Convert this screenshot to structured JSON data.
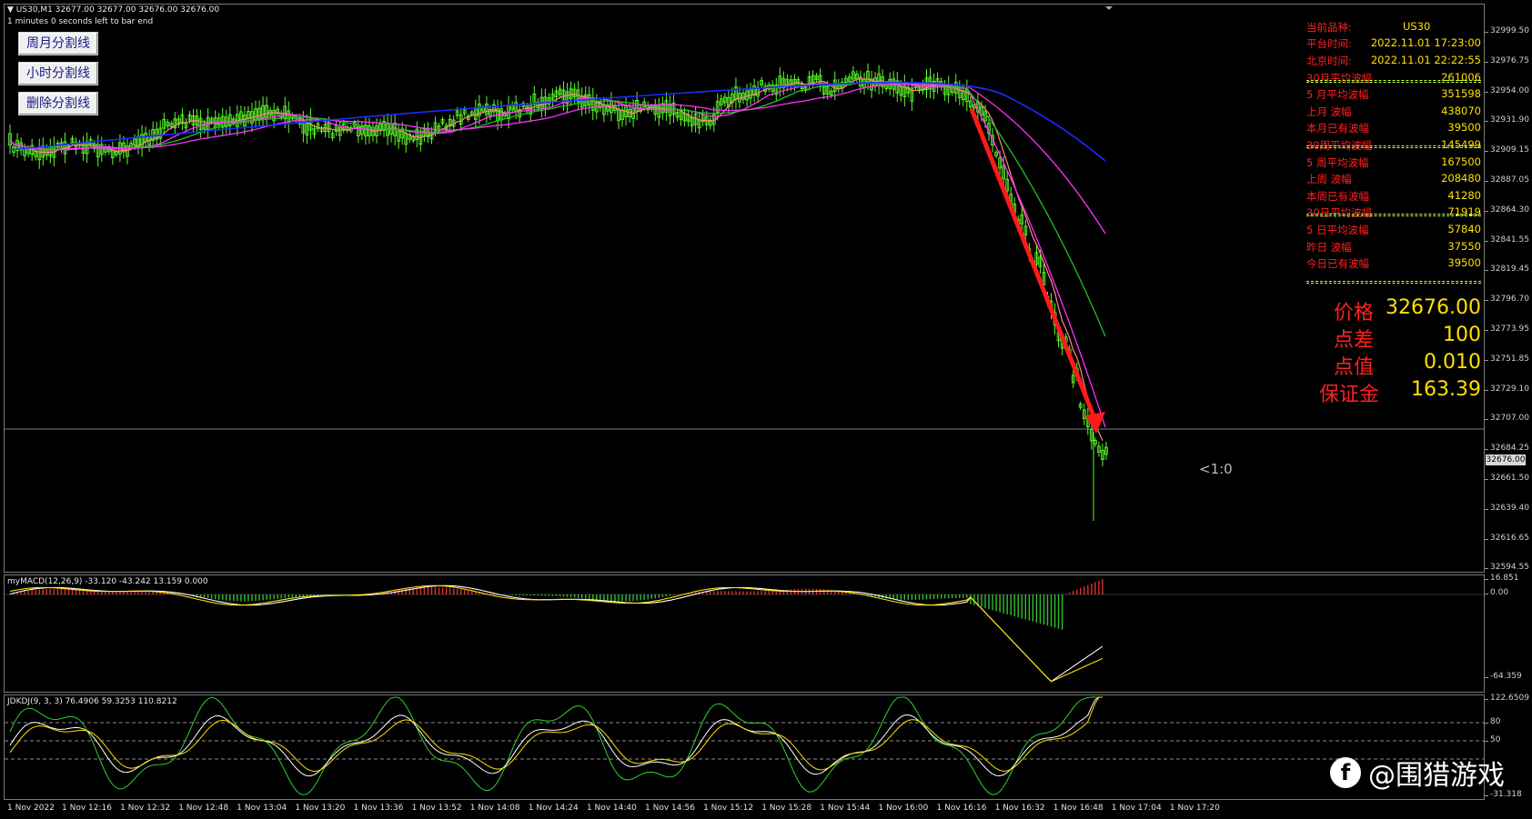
{
  "header": {
    "symbol_line": "US30,M1  32677.00 32677.00 32676.00 32676.00",
    "countdown": "1 minutes 0 seconds left to bar end"
  },
  "buttons": [
    {
      "label": "周月分割线"
    },
    {
      "label": "小时分割线"
    },
    {
      "label": "删除分割线"
    }
  ],
  "info_panel": {
    "rows": [
      {
        "key": "当前品种:",
        "value": "US30",
        "center": true
      },
      {
        "key": "平台时间:",
        "value": "2022.11.01 17:23:00"
      },
      {
        "key": "北京时间:",
        "value": "2022.11.01 22:22:55"
      },
      {
        "key": "30月平均波幅",
        "value": "261006"
      },
      {
        "key": "5 月平均波幅",
        "value": "351598"
      },
      {
        "key": "上月      波幅",
        "value": "438070"
      },
      {
        "key": "本月已有波幅",
        "value": "39500"
      },
      {
        "key": "30周平均波幅",
        "value": "145499"
      },
      {
        "key": "5 周平均波幅",
        "value": "167500"
      },
      {
        "key": "上周      波幅",
        "value": "208480"
      },
      {
        "key": "本周已有波幅",
        "value": "41280"
      },
      {
        "key": "30日平均波幅",
        "value": "71919"
      },
      {
        "key": "5 日平均波幅",
        "value": "57840"
      },
      {
        "key": "昨日      波幅",
        "value": "37550"
      },
      {
        "key": "今日已有波幅",
        "value": "39500"
      }
    ],
    "big_rows": [
      {
        "key": "价格",
        "value": "32676.00"
      },
      {
        "key": "点差",
        "value": "100"
      },
      {
        "key": "点值",
        "value": "0.010"
      },
      {
        "key": "保证金",
        "value": "163.39"
      }
    ]
  },
  "price_scale": [
    "32999.50",
    "32976.75",
    "32954.00",
    "32931.90",
    "32909.15",
    "32887.05",
    "32864.30",
    "32841.55",
    "32819.45",
    "32796.70",
    "32773.95",
    "32751.85",
    "32729.10",
    "32707.00",
    "32684.25",
    "32661.50",
    "32639.40",
    "32616.65",
    "32594.55"
  ],
  "current_price_label": "32676.00",
  "ratio_label": "<1:0",
  "macd": {
    "title": "myMACD(12,26,9) -33.120 -43.242 13.159 0.000",
    "scale": [
      "16.851",
      "0.00",
      "-64.359"
    ]
  },
  "kdj": {
    "title": "JDKDJ(9, 3, 3) 76.4906 59.3253 110.8212",
    "scale": [
      "122.6509",
      "80",
      "50",
      "-31.318"
    ]
  },
  "time_axis": [
    "1 Nov 2022",
    "1 Nov 12:16",
    "1 Nov 12:32",
    "1 Nov 12:48",
    "1 Nov 13:04",
    "1 Nov 13:20",
    "1 Nov 13:36",
    "1 Nov 13:52",
    "1 Nov 14:08",
    "1 Nov 14:24",
    "1 Nov 14:40",
    "1 Nov 14:56",
    "1 Nov 15:12",
    "1 Nov 15:28",
    "1 Nov 15:44",
    "1 Nov 16:00",
    "1 Nov 16:16",
    "1 Nov 16:32",
    "1 Nov 16:48",
    "1 Nov 17:04",
    "1 Nov 17:20"
  ],
  "watermark": {
    "icon": "f",
    "text": "@围猎游戏"
  },
  "colors": {
    "candle": "#5dff2a",
    "ma_fast": "#ff8a80",
    "ma_mid": "#ff30ff",
    "ma_slow": "#22c022",
    "ma_long": "#1c2cff",
    "arrow": "#ff1a1a",
    "info_key": "#ff2020",
    "info_value": "#ffe000"
  }
}
